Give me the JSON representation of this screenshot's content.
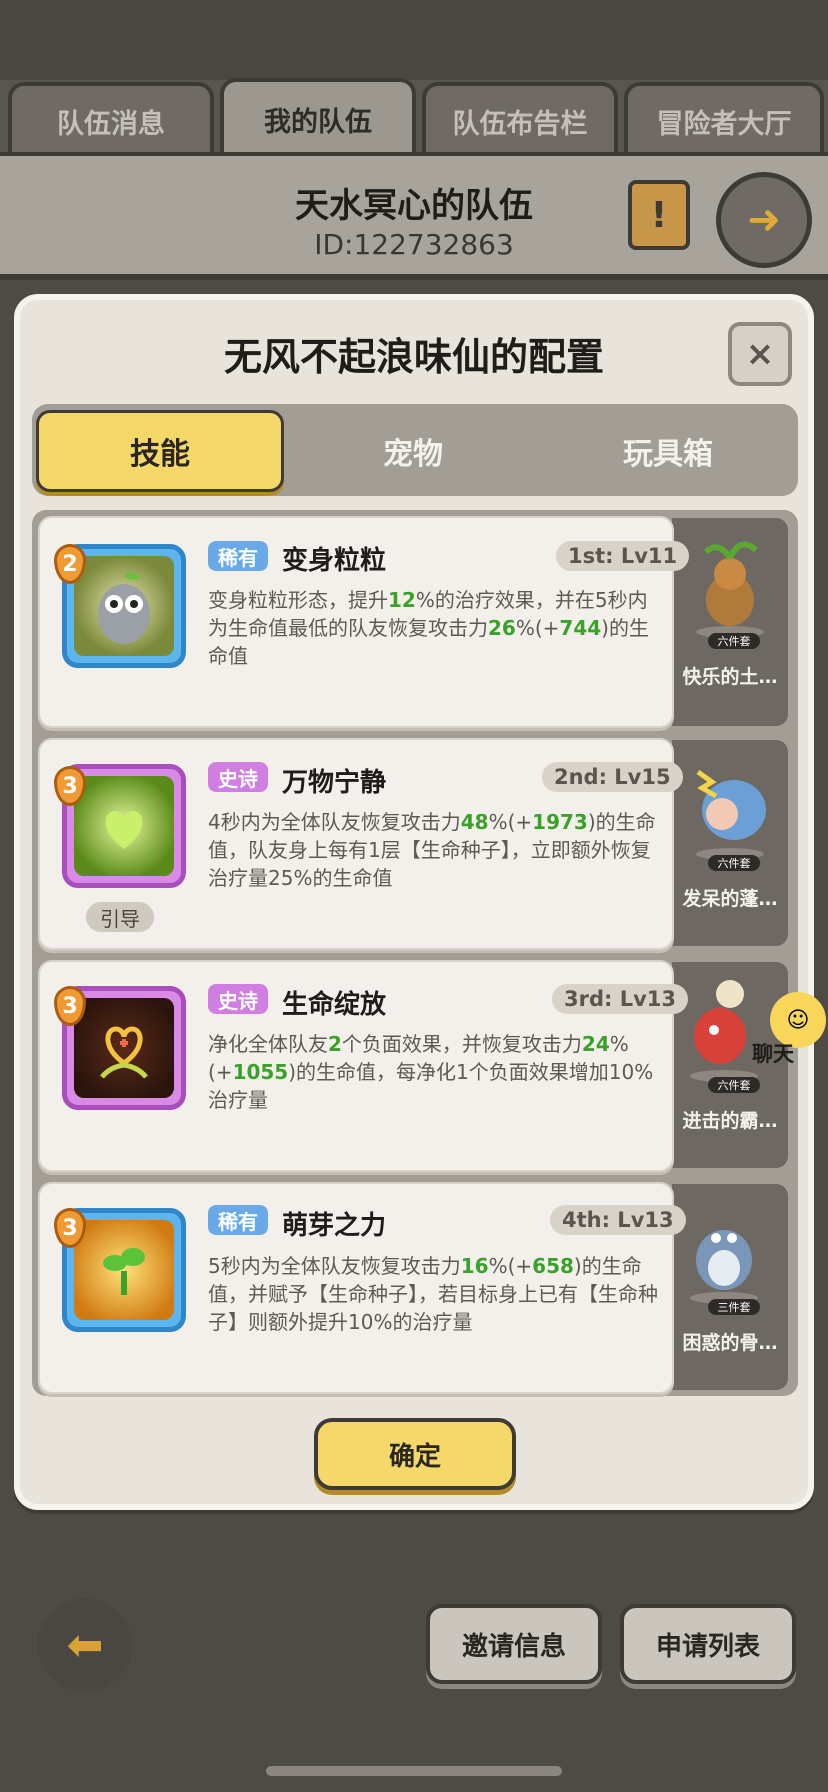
{
  "tabs": [
    "队伍消息",
    "我的队伍",
    "队伍布告栏",
    "冒险者大厅"
  ],
  "team": {
    "name": "天水冥心的队伍",
    "id": "ID:122732863"
  },
  "modal": {
    "title": "无风不起浪味仙的配置",
    "close": "×",
    "segments": [
      "技能",
      "宠物",
      "玩具箱"
    ],
    "confirm": "确定"
  },
  "skills": [
    {
      "level": "2",
      "rarity": "稀有",
      "name": "变身粒粒",
      "slot": "1st: Lv11",
      "desc": [
        "变身粒粒形态，提升",
        "12",
        "%的治疗效果，并在5秒内为生命值最低的队友恢复攻击力",
        "26",
        "%(+",
        "744",
        ")的生命值"
      ]
    },
    {
      "level": "3",
      "rarity": "史诗",
      "name": "万物宁静",
      "slot": "2nd: Lv15",
      "tag": "引导",
      "desc": [
        "4秒内为全体队友恢复攻击力",
        "48",
        "%(+",
        "1973",
        ")的生命值，队友身上每有1层【生命种子】，立即额外恢复治疗量25%的生命值"
      ]
    },
    {
      "level": "3",
      "rarity": "史诗",
      "name": "生命绽放",
      "slot": "3rd: Lv13",
      "desc": [
        "净化全体队友",
        "2",
        "个负面效果，并恢复攻击力",
        "24",
        "%(+",
        "1055",
        ")的生命值，每净化1个负面效果增加10%治疗量"
      ]
    },
    {
      "level": "3",
      "rarity": "稀有",
      "name": "萌芽之力",
      "slot": "4th: Lv13",
      "desc": [
        "5秒内为全体队友恢复攻击力",
        "16",
        "%(+",
        "658",
        ")的生命值，并赋予【生命种子】，若目标身上已有【生命种子】则额外提升10%的治疗量"
      ]
    }
  ],
  "pets": [
    {
      "name": "快乐的土…",
      "set": "六件套"
    },
    {
      "name": "发呆的蓬…",
      "set": "六件套"
    },
    {
      "name": "进击的霸…",
      "set": "六件套"
    },
    {
      "name": "困惑的骨…",
      "set": "三件套"
    }
  ],
  "chat": "聊天",
  "bottom": {
    "invite": "邀请信息",
    "apply": "申请列表"
  },
  "colors": {
    "accent": "#f5d76a",
    "highlight": "#3aa12a",
    "rare": "#6aa9e8",
    "epic": "#d17ee3"
  }
}
